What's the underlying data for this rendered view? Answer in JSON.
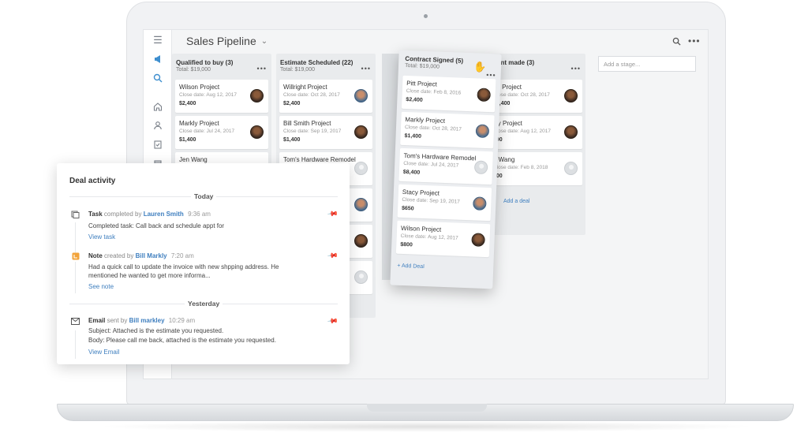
{
  "app": {
    "title": "Sales Pipeline",
    "add_stage_placeholder": "Add a stage..."
  },
  "columns": [
    {
      "title": "Qualified to buy (3)",
      "total": "Total: $19,000",
      "cards": [
        {
          "title": "Wilson Project",
          "date": "Close date: Aug 12, 2017",
          "amount": "$2,400",
          "avatar": "dark"
        },
        {
          "title": "Markly Project",
          "date": "Close date: Jul 24, 2017",
          "amount": "$1,400",
          "avatar": "dark"
        },
        {
          "title": "Jen Wang",
          "date": "",
          "amount": "",
          "avatar": "none"
        }
      ]
    },
    {
      "title": "Estimate Scheduled (22)",
      "total": "Total: $19,000",
      "cards": [
        {
          "title": "Willright Project",
          "date": "Close date: Oct 28, 2017",
          "amount": "$2,400",
          "avatar": "blue"
        },
        {
          "title": "Bill Smith Project",
          "date": "Close date: Sep 19, 2017",
          "amount": "$1,400",
          "avatar": "dark"
        },
        {
          "title": "Tom's Hardware Remodel",
          "date": "",
          "amount": "",
          "avatar": "grey"
        },
        {
          "title": "",
          "date": "",
          "amount": "",
          "avatar": "blue"
        },
        {
          "title": "",
          "date": "",
          "amount": "",
          "avatar": "dark"
        },
        {
          "title": "",
          "date": "",
          "amount": "",
          "avatar": "grey"
        }
      ]
    },
    {
      "title": "Contract Signed (5)",
      "total": "Total: $19,000",
      "cards": [
        {
          "title": "Pitt Project",
          "date": "Close date: Feb 8, 2016",
          "amount": "$2,400",
          "avatar": "dark"
        },
        {
          "title": "Markly Project",
          "date": "Close date: Oct 28, 2017",
          "amount": "$1,400",
          "avatar": "blue"
        },
        {
          "title": "Tom's Hardware Remodel",
          "date": "Close date: Jul 24, 2017",
          "amount": "$8,400",
          "avatar": "grey"
        },
        {
          "title": "Stacy Project",
          "date": "Close date: Sep 19, 2017",
          "amount": "$650",
          "avatar": "blue"
        },
        {
          "title": "Wilson Project",
          "date": "Close date: Aug 12, 2017",
          "amount": "$800",
          "avatar": "dark"
        }
      ],
      "add_deal": "+ Add Deal"
    },
    {
      "title": "ent made (3)",
      "total": "",
      "cards": [
        {
          "title": "on Project",
          "date": "Close date: Oct 28, 2017",
          "amount": "$2,400",
          "avatar": "dark"
        },
        {
          "title": "kly Project",
          "date": "Close date: Aug 12, 2017",
          "amount": "800",
          "avatar": "dark"
        },
        {
          "title": "n Wang",
          "date": "Close date: Feb 8, 2018",
          "amount": "400",
          "avatar": "grey"
        }
      ],
      "add_deal": "Add a deal"
    }
  ],
  "activity": {
    "title": "Deal activity",
    "today": "Today",
    "yesterday": "Yesterday",
    "items": [
      {
        "type": "Task",
        "verb": "completed by",
        "who": "Lauren Smith",
        "time": "9:36 am",
        "lines": [
          "Completed task: Call back and schedule appt for"
        ],
        "link": "View task"
      },
      {
        "type": "Note",
        "verb": "created by",
        "who": "Bill Markly",
        "time": "7:20 am",
        "lines": [
          "Had a quick call to update the invoice with new shpping address. He",
          "mentioned he wanted to get more informa..."
        ],
        "link": "See note"
      },
      {
        "type": "Email",
        "verb": "sent by",
        "who": "Bill markley",
        "time": "10:29 am",
        "lines": [
          "Subject: Attached is the estimate you requested.",
          "Body: Please call me back, attached is the estimate you requested."
        ],
        "link": "View Email"
      }
    ]
  },
  "colors": {
    "accent": "#3f7fbf",
    "note": "#f2a33a"
  }
}
